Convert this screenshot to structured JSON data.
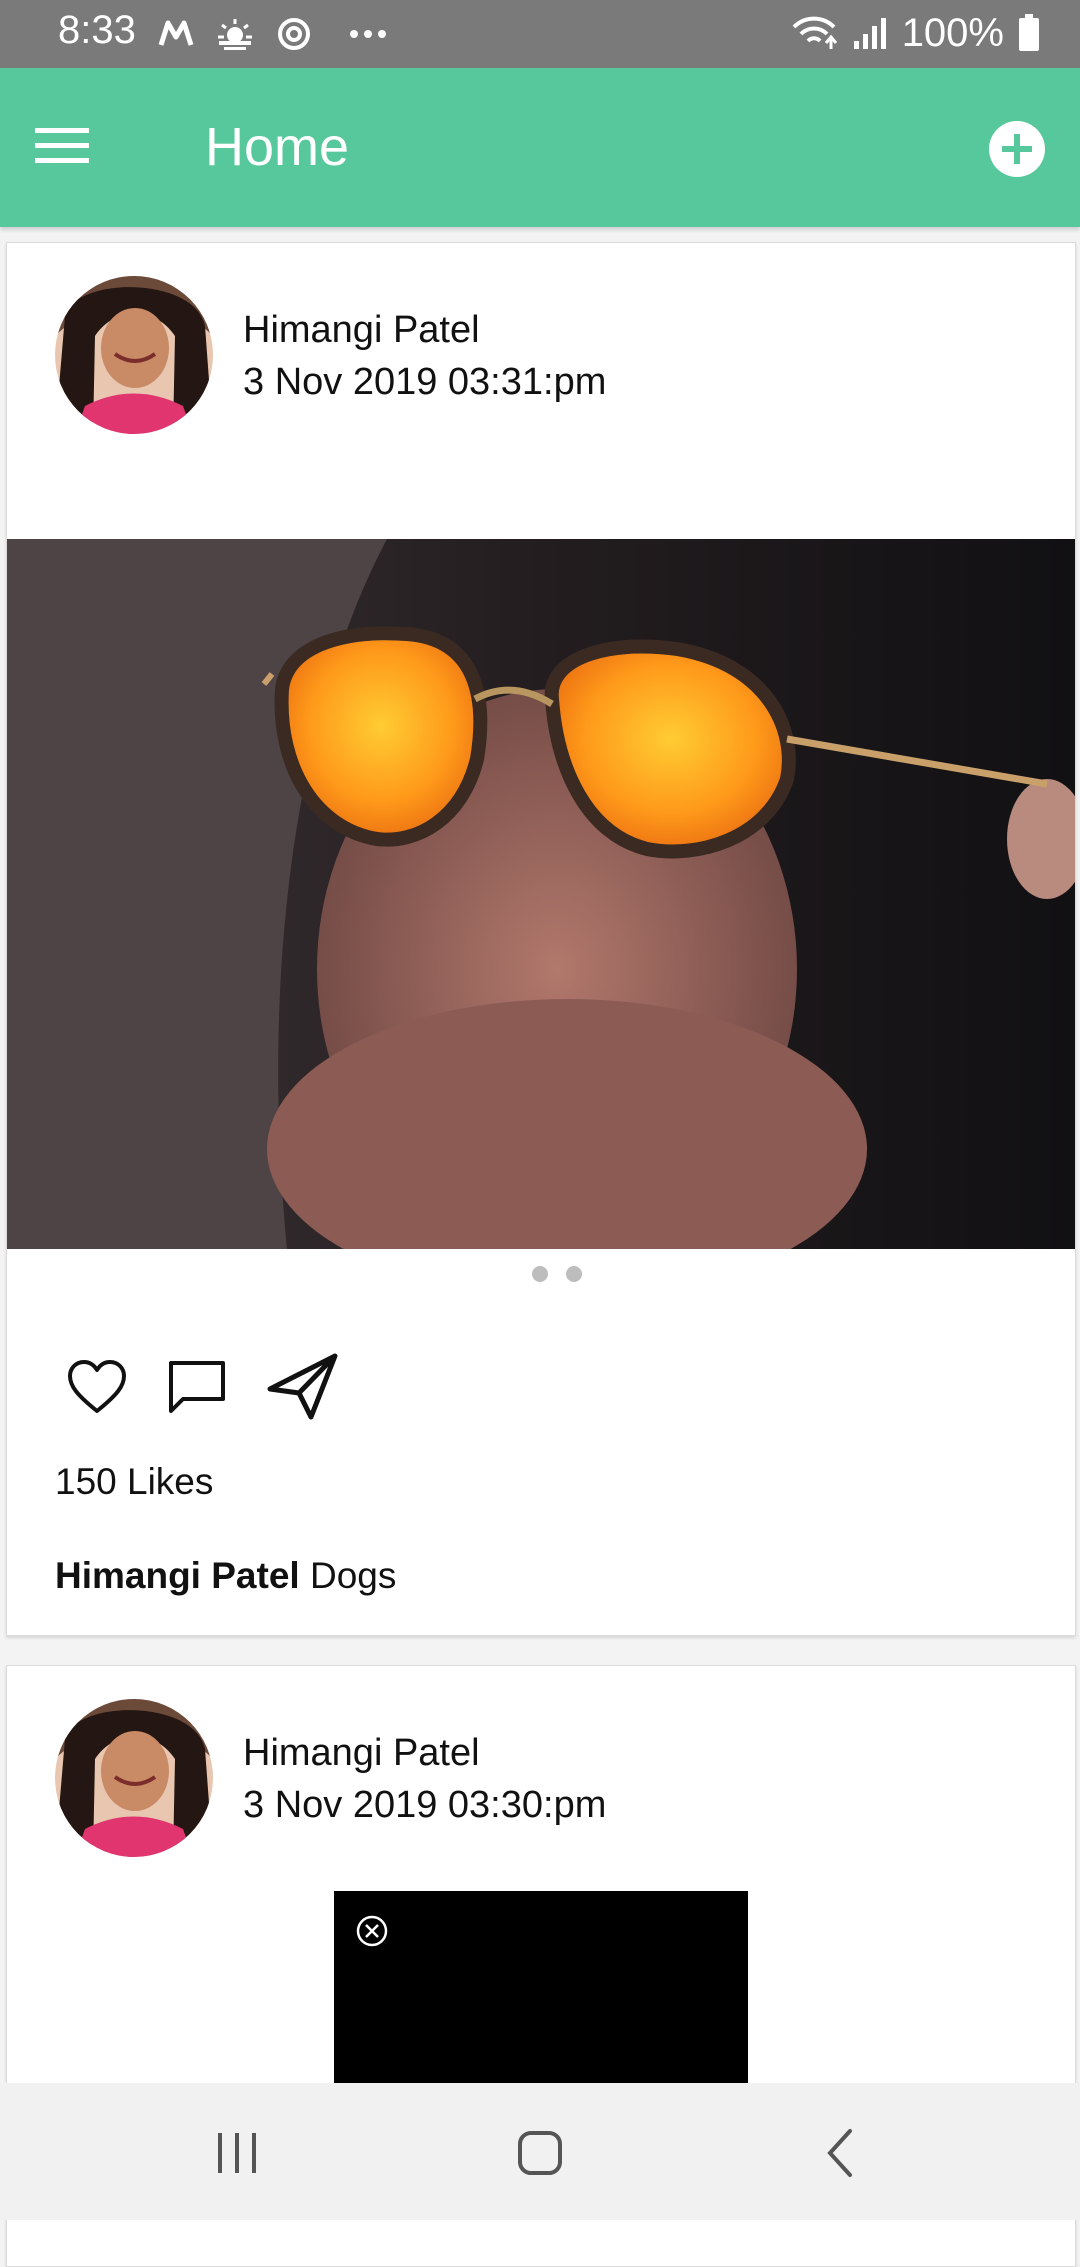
{
  "status_bar": {
    "time": "8:33",
    "battery": "100%",
    "icons": [
      "m-icon",
      "weather-icon",
      "sync-icon",
      "more-icon",
      "wifi-icon",
      "signal-icon",
      "battery-icon"
    ]
  },
  "app_bar": {
    "title": "Home",
    "menu_icon": "menu-icon",
    "add_icon": "add-circle-icon",
    "color": "#57c89c"
  },
  "posts": [
    {
      "author": "Himangi Patel",
      "date": "3 Nov 2019 03:31:pm",
      "likes": "150 Likes",
      "caption_author": "Himangi Patel",
      "caption_text": " Dogs",
      "carousel_pages": 2,
      "actions": [
        "heart-icon",
        "comment-icon",
        "send-icon"
      ]
    },
    {
      "author": "Himangi Patel",
      "date": "3 Nov 2019 03:30:pm"
    }
  ],
  "nav_bar": {
    "icons": [
      "recent-apps-icon",
      "home-icon",
      "back-icon"
    ]
  }
}
